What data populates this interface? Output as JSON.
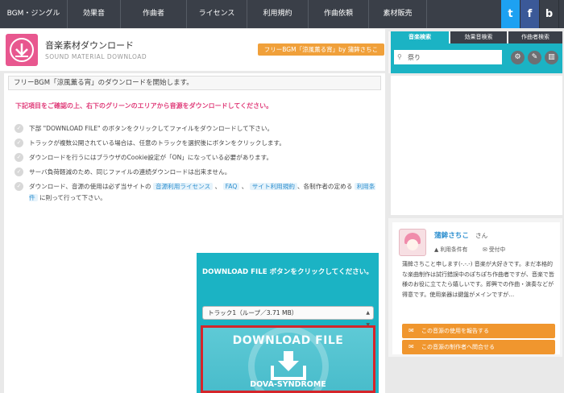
{
  "nav": {
    "items": [
      "BGM・ジングル",
      "効果音",
      "作曲者",
      "ライセンス",
      "利用規約",
      "作曲依頼",
      "素材販売"
    ],
    "twitter": "t",
    "facebook": "f",
    "other": "b"
  },
  "header": {
    "title": "音楽素材ダウンロード",
    "subtitle": "SOUND MATERIAL DOWNLOAD",
    "tag": "フリーBGM「涼風薫る宵」by 蒲鉾さちこ"
  },
  "main": {
    "start_message": "フリーBGM「涼風薫る宵」のダウンロードを開始します。",
    "notice": "下記項目をご確認の上、右下のグリーンのエリアから音源をダウンロードしてください。",
    "bullets": [
      "下部 \"DOWNLOAD FILE\" のボタンをクリックしてファイルをダウンロードして下さい。",
      "トラックが複数公開されている場合は、任意のトラックを選択後にボタンをクリックします。",
      "ダウンロードを行うにはブラウザのCookie設定が「ON」になっている必要があります。",
      "サーバ負荷軽減のため、同じファイルの連続ダウンロードは出来ません。"
    ],
    "last_bullet": {
      "part1": "ダウンロード、音源の使用は必ず当サイトの",
      "link1": "音源利用ライセンス",
      "sep1": "、",
      "link2": "FAQ",
      "sep2": "、",
      "link3": "サイト利用規約",
      "part2": "、各制作者の定める",
      "link4": "利用条件",
      "part3": "に則って行って下さい。"
    }
  },
  "download": {
    "heading": "DOWNLOAD FILE ボタンをクリックしてください。",
    "selected_track": "トラック1（ループ／3.71 MB）",
    "button_text": "DOWNLOAD FILE",
    "brand": "DOVA-SYNDROME"
  },
  "sidebar": {
    "tabs": [
      "音楽検索",
      "効果音検索",
      "作曲者検索"
    ],
    "search_value": "祭り"
  },
  "author": {
    "name": "蒲鉾さちこ",
    "honorific": "さん",
    "badge_license": "利用条件有",
    "badge_orders": "受付中",
    "bio": "蒲鉾さちこと申します(-.-.-) 音楽が大好きです。まだ本格的な楽曲制作は試行錯誤中のぽちぽち作曲者ですが、音楽で皆様のお役に立てたら嬉しいです。即興での作曲・演奏などが得意です。使用楽器は鍵盤がメインですが…",
    "report_label": "この音源の使用を報告する",
    "contact_label": "この音源の制作者へ問合せる"
  },
  "colors": {
    "nav_bg": "#3a3f48",
    "teal": "#1bb3c4",
    "orange": "#f0962e",
    "pink": "#e03d7a",
    "highlight_border": "#d5252a"
  }
}
